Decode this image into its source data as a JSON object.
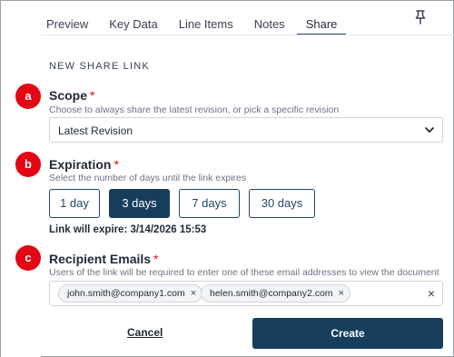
{
  "tabs": [
    {
      "label": "Preview",
      "active": false
    },
    {
      "label": "Key Data",
      "active": false
    },
    {
      "label": "Line Items",
      "active": false
    },
    {
      "label": "Notes",
      "active": false
    },
    {
      "label": "Share",
      "active": true
    }
  ],
  "header": {
    "pin_icon": "pin-icon"
  },
  "section_title": "NEW SHARE LINK",
  "scope": {
    "badge": "a",
    "label": "Scope",
    "required_mark": "*",
    "help": "Choose to always share the latest revision, or pick a specific revision",
    "selected": "Latest Revision"
  },
  "expiration": {
    "badge": "b",
    "label": "Expiration",
    "required_mark": "*",
    "help": "Select the number of days until the link expires",
    "options": [
      {
        "label": "1 day",
        "active": false
      },
      {
        "label": "3 days",
        "active": true
      },
      {
        "label": "7 days",
        "active": false
      },
      {
        "label": "30 days",
        "active": false
      }
    ],
    "expire_text": "Link will expire: 3/14/2026 15:53"
  },
  "recipients": {
    "badge": "c",
    "label": "Recipient Emails",
    "required_mark": "*",
    "help": "Users of the link will be required to enter one of these email addresses to view the document",
    "emails": [
      "john.smith@company1.com",
      "helen.smith@company2.com"
    ],
    "remove_glyph": "×"
  },
  "footer": {
    "cancel_label": "Cancel",
    "create_label": "Create"
  },
  "colors": {
    "accent": "#163d5c",
    "badge": "#e30613",
    "required": "#e30613"
  }
}
